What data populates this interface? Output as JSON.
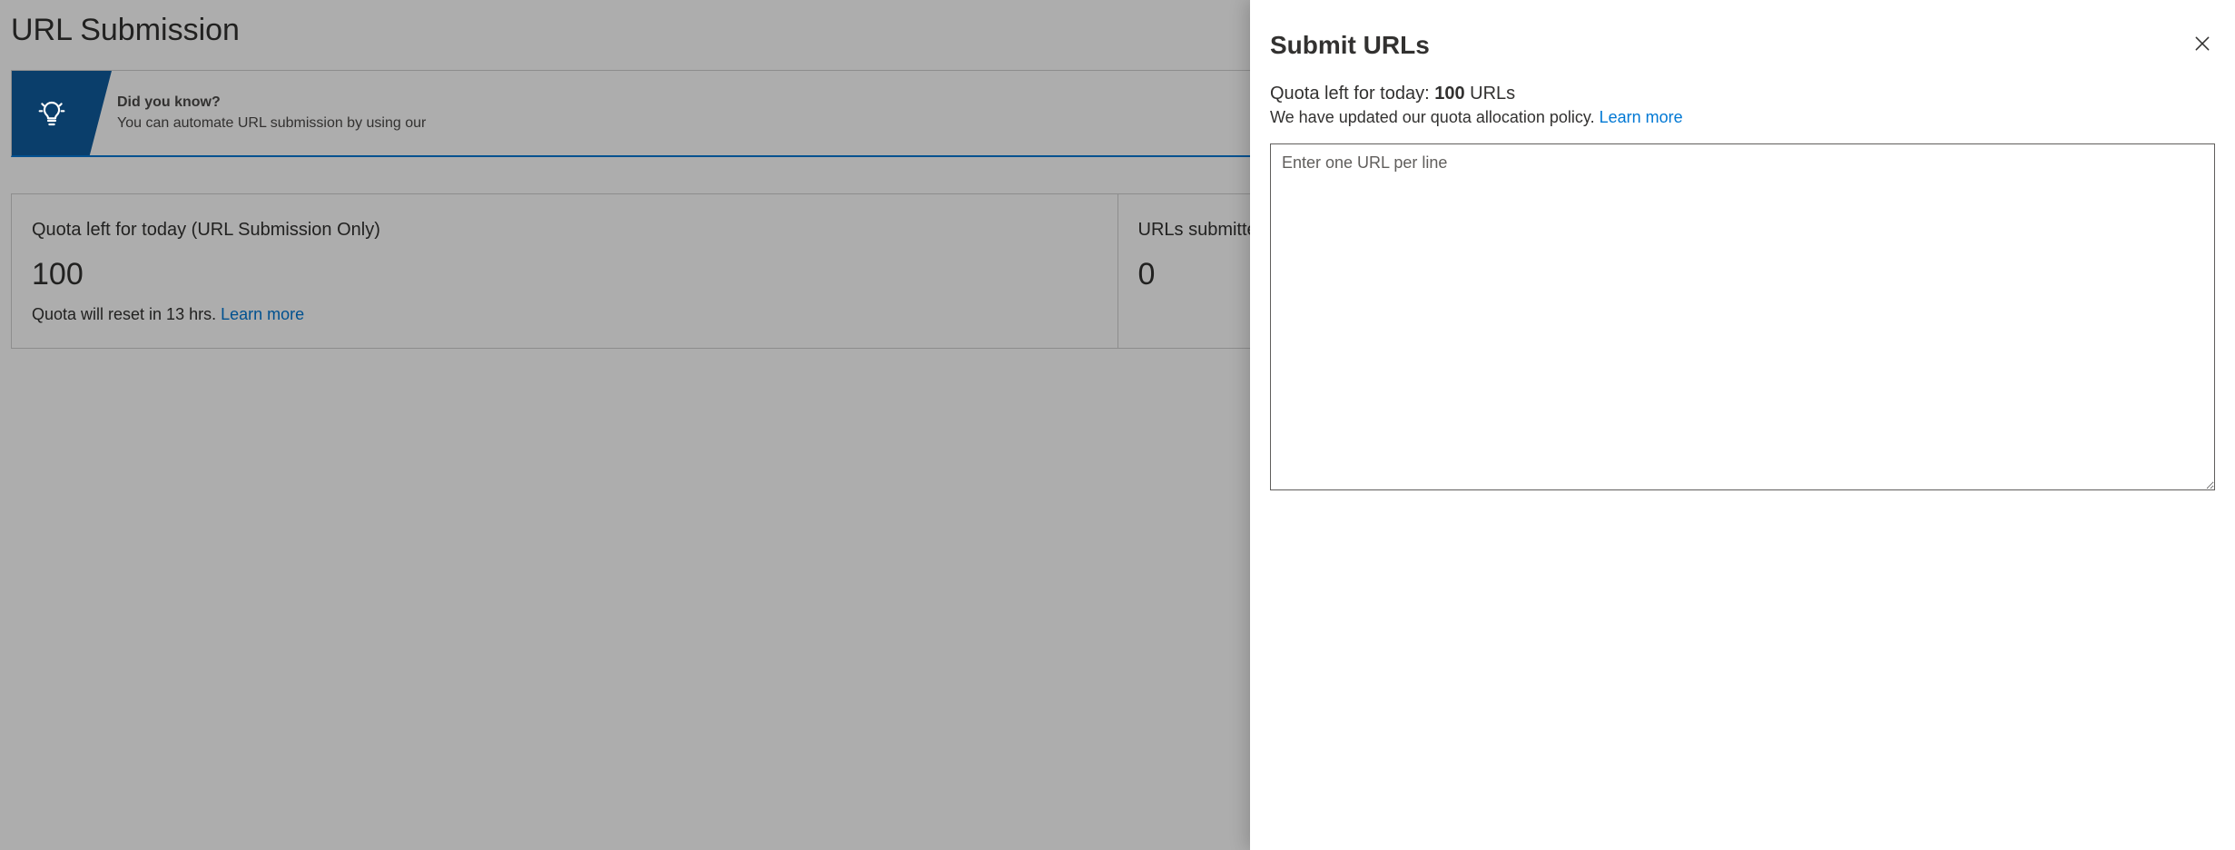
{
  "page": {
    "title": "URL Submission",
    "info_bar": {
      "heading": "Did you know?",
      "subtext": "You can automate URL submission by using our"
    },
    "cards": {
      "quota": {
        "label": "Quota left for today (URL Submission Only)",
        "value": "100",
        "subtext": "Quota will reset in 13 hrs.",
        "learn_more": "Learn more"
      },
      "submitted": {
        "label": "URLs submitted",
        "value": "0"
      }
    }
  },
  "panel": {
    "title": "Submit URLs",
    "quota_prefix": "Quota left for today: ",
    "quota_value": "100",
    "quota_suffix": " URLs",
    "policy_text": "We have updated our quota allocation policy. ",
    "policy_link": "Learn more",
    "textarea_placeholder": "Enter one URL per line"
  }
}
